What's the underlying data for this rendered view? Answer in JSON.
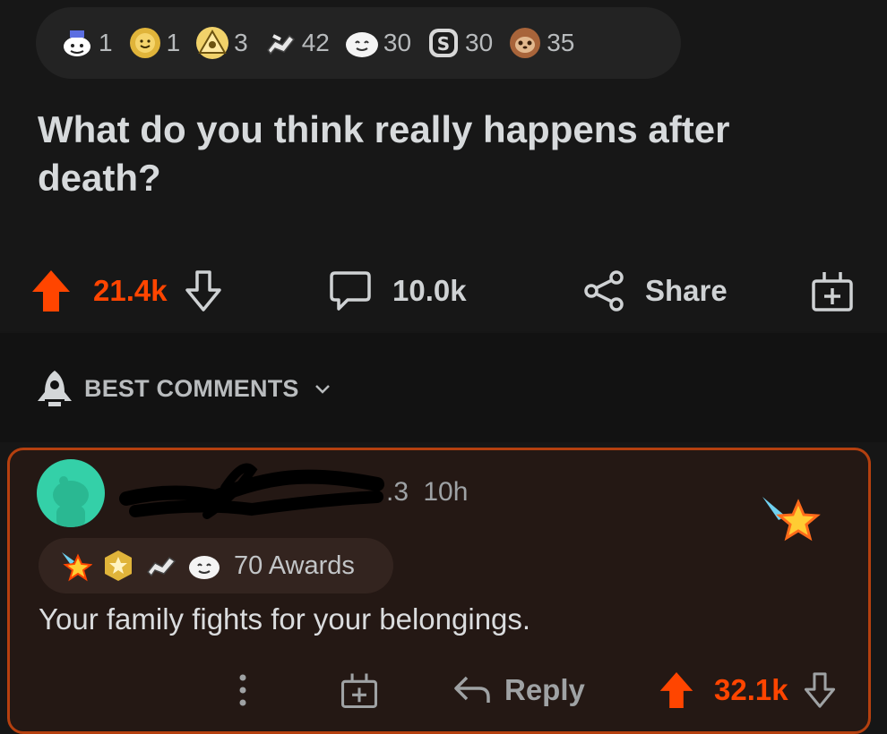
{
  "post": {
    "awards": [
      {
        "icon": "mascot-award-icon",
        "count": "1"
      },
      {
        "icon": "sun-award-icon",
        "count": "1"
      },
      {
        "icon": "pyramid-award-icon",
        "count": "3"
      },
      {
        "icon": "handshake-award-icon",
        "count": "42"
      },
      {
        "icon": "wholesome-award-icon",
        "count": "30"
      },
      {
        "icon": "silver-award-icon",
        "count": "30"
      },
      {
        "icon": "sloth-award-icon",
        "count": "35"
      }
    ],
    "title": "What do you think really happens after death?",
    "upvotes": "21.4k",
    "comments": "10.0k",
    "share_label": "Share"
  },
  "sort": {
    "label": "BEST COMMENTS"
  },
  "comment": {
    "username_tail": ".3",
    "time": "10h",
    "awards_label": "70 Awards",
    "body": "Your family fights for your belongings.",
    "reply_label": "Reply",
    "upvotes": "32.1k"
  },
  "colors": {
    "accent": "#ff4500",
    "background": "#161616",
    "comment_bg": "#241814",
    "comment_border": "#b5400f",
    "avatar": "#34d0a8"
  }
}
